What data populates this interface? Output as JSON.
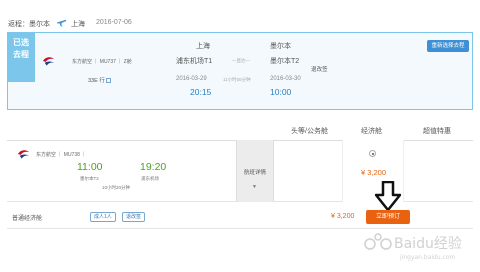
{
  "header": {
    "return_label": "返程：墨尔本",
    "to_city": "上海",
    "date": "2016-07-06"
  },
  "selected_flight": {
    "tag_line1": "已选",
    "tag_line2": "去程",
    "airline": "东方航空 ｜ MU737 ｜ Z舱",
    "aircraft": "33E 行",
    "reselect_label": "重新选择去程",
    "from_city": "上海",
    "from_airport": "浦东机场T1",
    "via_label": "—直达—",
    "to_city": "墨尔本",
    "to_airport": "墨尔本T2",
    "refund_label": "退改签",
    "dep_date": "2016-03-29",
    "duration": "11小时55分钟",
    "arr_date": "2016-03-30",
    "dep_time": "20:15",
    "arr_time": "10:00"
  },
  "cabins": {
    "first_business": "头等/公务舱",
    "economy": "经济舱",
    "super_deal": "超值特惠"
  },
  "flight_row": {
    "airline": "东方航空 ｜ MU738 ｜",
    "dep_time": "11:00",
    "arr_time": "19:20",
    "dep_airport": "墨尔本T2",
    "arr_airport": "浦东机场",
    "duration": "10小时20分钟",
    "detail_label": "航班详情",
    "detail_arrow": "▼",
    "economy_price": "¥ 3,200"
  },
  "booking_row": {
    "label": "普通经济舱",
    "tag1": "成人1人",
    "tag2": "退改签",
    "price": "¥ 3,200",
    "book_button": "立即预订"
  },
  "watermark": {
    "text": "Baidu经验",
    "sub": "jingyan.baidu.com"
  },
  "colors": {
    "accent_blue": "#3d8fd6",
    "light_blue": "#7cc6ec",
    "orange": "#e8620f",
    "green": "#4da21f"
  }
}
